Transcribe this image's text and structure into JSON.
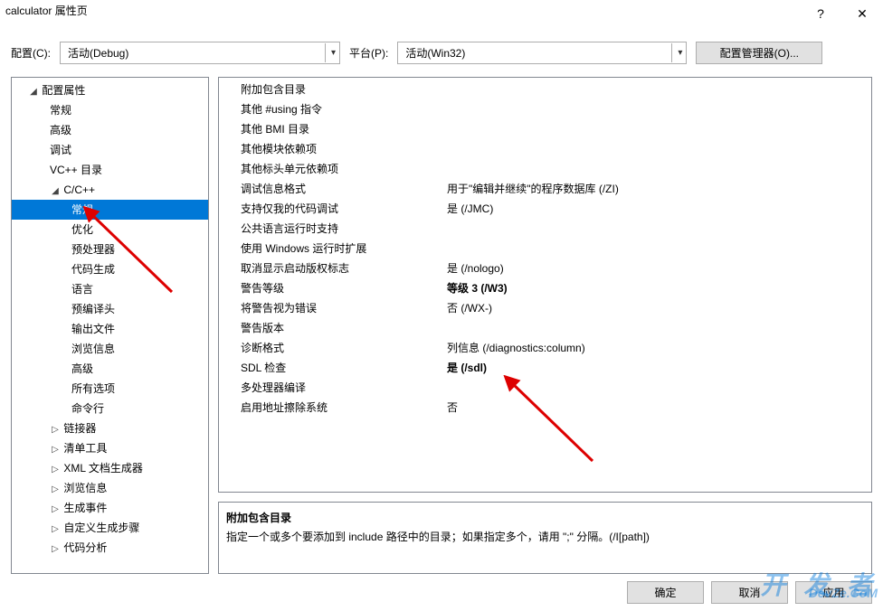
{
  "window": {
    "title": "calculator 属性页",
    "help_icon": "?",
    "close_icon": "✕"
  },
  "topbar": {
    "config_label": "配置(C):",
    "config_value": "活动(Debug)",
    "platform_label": "平台(P):",
    "platform_value": "活动(Win32)",
    "manager_btn": "配置管理器(O)..."
  },
  "tree": [
    {
      "lvl": 1,
      "tw": "◢",
      "label": "配置属性"
    },
    {
      "lvl": 2,
      "label": "常规"
    },
    {
      "lvl": 2,
      "label": "高级"
    },
    {
      "lvl": 2,
      "label": "调试"
    },
    {
      "lvl": 2,
      "label": "VC++ 目录"
    },
    {
      "lvl": 2,
      "tw": "◢",
      "label": "C/C++"
    },
    {
      "lvl": 3,
      "sel": true,
      "label": "常规"
    },
    {
      "lvl": 3,
      "label": "优化"
    },
    {
      "lvl": 3,
      "label": "预处理器"
    },
    {
      "lvl": 3,
      "label": "代码生成"
    },
    {
      "lvl": 3,
      "label": "语言"
    },
    {
      "lvl": 3,
      "label": "预编译头"
    },
    {
      "lvl": 3,
      "label": "输出文件"
    },
    {
      "lvl": 3,
      "label": "浏览信息"
    },
    {
      "lvl": 3,
      "label": "高级"
    },
    {
      "lvl": 3,
      "label": "所有选项"
    },
    {
      "lvl": 3,
      "label": "命令行"
    },
    {
      "lvl": 2,
      "tw": "▷",
      "label": "链接器"
    },
    {
      "lvl": 2,
      "tw": "▷",
      "label": "清单工具"
    },
    {
      "lvl": 2,
      "tw": "▷",
      "label": "XML 文档生成器"
    },
    {
      "lvl": 2,
      "tw": "▷",
      "label": "浏览信息"
    },
    {
      "lvl": 2,
      "tw": "▷",
      "label": "生成事件"
    },
    {
      "lvl": 2,
      "tw": "▷",
      "label": "自定义生成步骤"
    },
    {
      "lvl": 2,
      "tw": "▷",
      "label": "代码分析"
    }
  ],
  "props": [
    {
      "name": "附加包含目录",
      "value": ""
    },
    {
      "name": "其他 #using 指令",
      "value": ""
    },
    {
      "name": "其他 BMI 目录",
      "value": ""
    },
    {
      "name": "其他模块依赖项",
      "value": ""
    },
    {
      "name": "其他标头单元依赖项",
      "value": ""
    },
    {
      "name": "调试信息格式",
      "value": "用于\"编辑并继续\"的程序数据库 (/ZI)"
    },
    {
      "name": "支持仅我的代码调试",
      "value": "是 (/JMC)"
    },
    {
      "name": "公共语言运行时支持",
      "value": ""
    },
    {
      "name": "使用 Windows 运行时扩展",
      "value": ""
    },
    {
      "name": "取消显示启动版权标志",
      "value": "是 (/nologo)"
    },
    {
      "name": "警告等级",
      "value": "等级 3 (/W3)",
      "bold": true
    },
    {
      "name": "将警告视为错误",
      "value": "否 (/WX-)"
    },
    {
      "name": "警告版本",
      "value": ""
    },
    {
      "name": "诊断格式",
      "value": "列信息 (/diagnostics:column)"
    },
    {
      "name": "SDL 检查",
      "value": "是 (/sdl)",
      "bold": true
    },
    {
      "name": "多处理器编译",
      "value": ""
    },
    {
      "name": "启用地址擦除系统",
      "value": "否"
    }
  ],
  "desc": {
    "heading": "附加包含目录",
    "body": "指定一个或多个要添加到 include 路径中的目录；如果指定多个，请用 \";\" 分隔。(/I[path])"
  },
  "footer": {
    "ok": "确定",
    "cancel": "取消",
    "apply": "应用"
  }
}
